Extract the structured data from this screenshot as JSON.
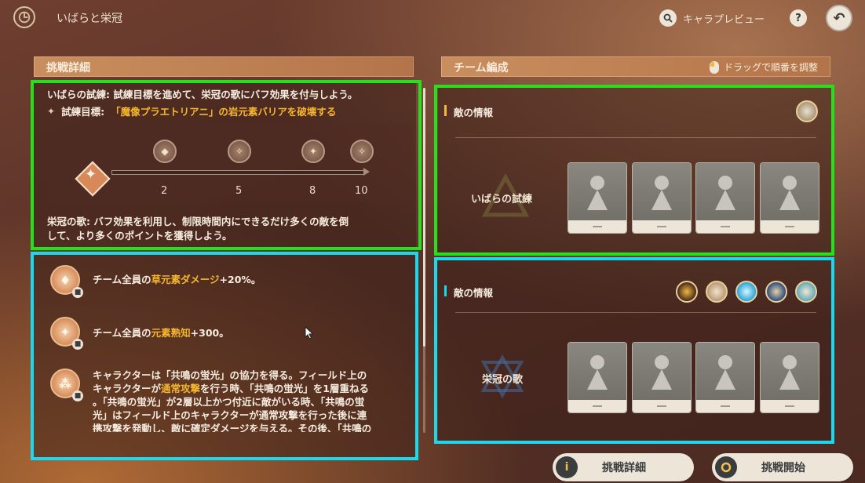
{
  "header": {
    "title": "いばらと栄冠",
    "preview_label": "キャラプレビュー",
    "help_glyph": "?",
    "back_glyph": "↶"
  },
  "left": {
    "section_title": "挑戦詳細",
    "trial_desc": "いばらの試練: 試練目標を進めて、栄冠の歌にバフ効果を付与しよう。",
    "goal_label": "試練目標:",
    "goal_text": "「魔像プラエトリアニ」の岩元素バリアを破壊する",
    "ticks": [
      "2",
      "5",
      "8",
      "10"
    ],
    "song_desc_1": "栄冠の歌: バフ効果を利用し、制限時間内にできるだけ多くの敵を倒",
    "song_desc_2": "して、より多くのポイントを獲得しよう。",
    "buffs": [
      {
        "pre": "チーム全員の",
        "hl": "草元素ダメージ",
        "post": "+20%。"
      },
      {
        "pre": "チーム全員の",
        "hl": "元素熟知",
        "post": "+300。"
      }
    ],
    "buff3": {
      "l1": "キャラクターは「共鳴の蛍光」の協力を得る。フィールド上の",
      "l2_pre": "キャラクターが",
      "l2_hl": "通常攻撃",
      "l2_post": "を行う時、「共鳴の蛍光」を1層重ねる",
      "l3": "。「共鳴の蛍光」が2層以上かつ付近に敵がいる時、「共鳴の蛍",
      "l4": "光」はフィールド上のキャラクターが通常攻撃を行った後に連",
      "l5": "携攻撃を発動し、敵に確定ダメージを与える。その後、「共鳴の"
    }
  },
  "right": {
    "section_title": "チーム編成",
    "drag_hint": "ドラッグで順番を調整",
    "team1": {
      "enemy_label": "敵の情報",
      "stage": "いばらの試練"
    },
    "team2": {
      "enemy_label": "敵の情報",
      "stage": "栄冠の歌"
    }
  },
  "buttons": {
    "details": "挑戦詳細",
    "details_icon": "i",
    "start": "挑戦開始",
    "start_icon": "O"
  },
  "colors": {
    "accent": "#f6b62e",
    "green_box": "#27e01c",
    "cyan_box": "#1ad9ee"
  }
}
